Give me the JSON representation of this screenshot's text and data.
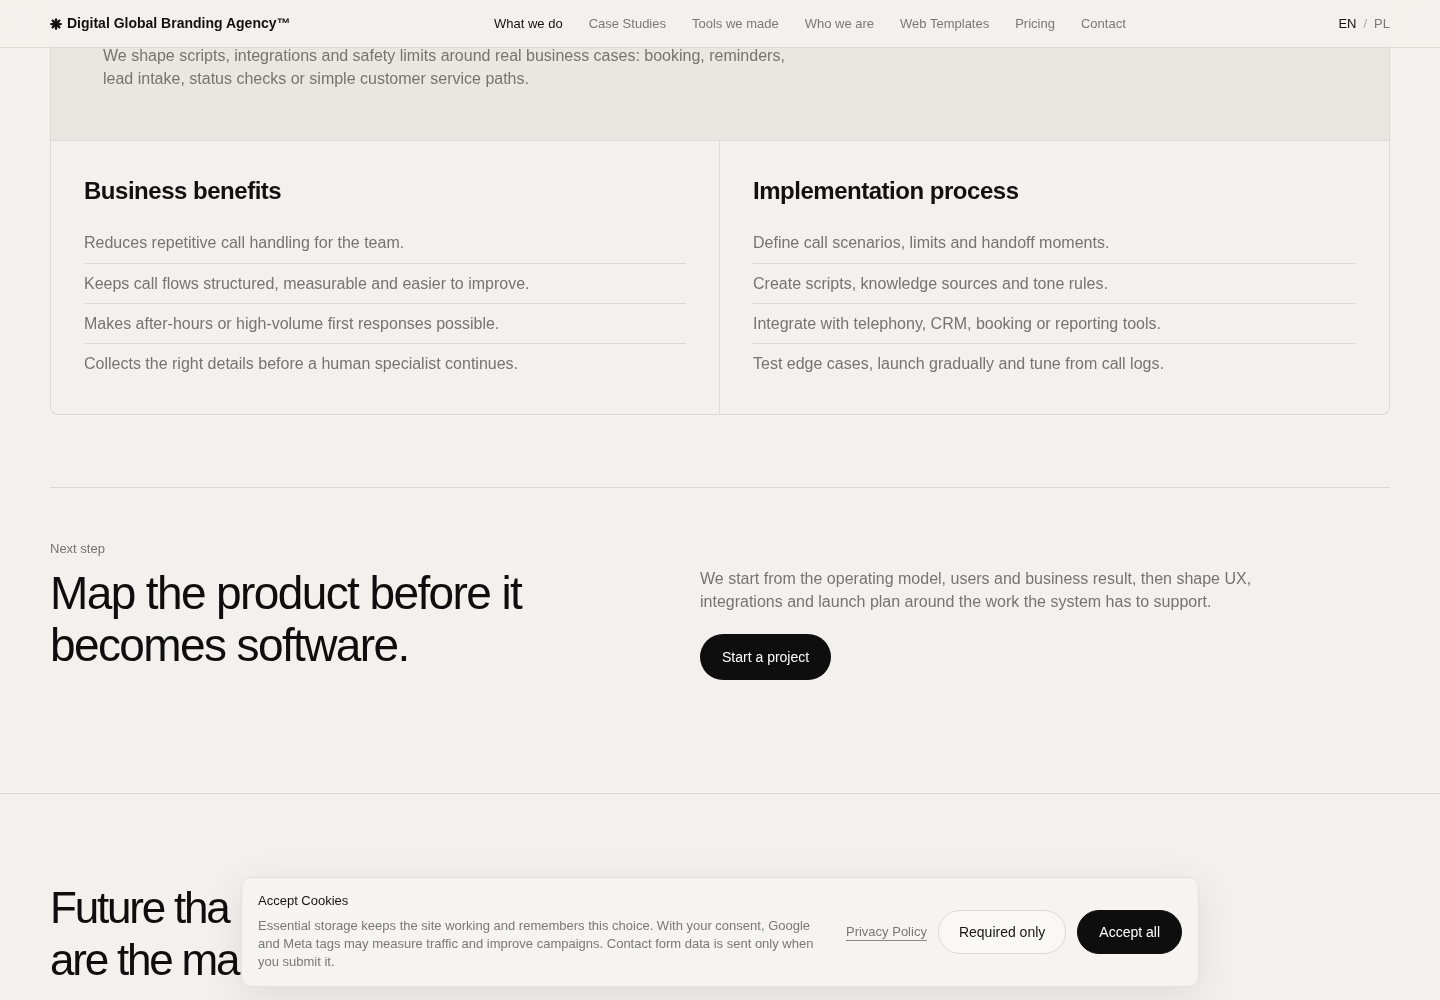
{
  "header": {
    "logo": "Digital Global Branding Agency™",
    "nav": [
      {
        "label": "What we do",
        "selected": true
      },
      {
        "label": "Case Studies",
        "selected": false
      },
      {
        "label": "Tools we made",
        "selected": false
      },
      {
        "label": "Who we are",
        "selected": false
      },
      {
        "label": "Web Templates",
        "selected": false
      },
      {
        "label": "Pricing",
        "selected": false
      },
      {
        "label": "Contact",
        "selected": false
      }
    ],
    "languages": [
      {
        "label": "EN",
        "selected": true
      },
      {
        "label": "PL",
        "selected": false
      }
    ],
    "language_separator": "/"
  },
  "intro": {
    "text": "We shape scripts, integrations and safety limits around real business cases: booking, reminders, lead intake, status checks or simple customer service paths."
  },
  "columns": [
    {
      "title": "Business benefits",
      "items": [
        "Reduces repetitive call handling for the team.",
        "Keeps call flows structured, measurable and easier to improve.",
        "Makes after-hours or high-volume first responses possible.",
        "Collects the right details before a human specialist continues."
      ]
    },
    {
      "title": "Implementation process",
      "items": [
        "Define call scenarios, limits and handoff moments.",
        "Create scripts, knowledge sources and tone rules.",
        "Integrate with telephony, CRM, booking or reporting tools.",
        "Test edge cases, launch gradually and tune from call logs."
      ]
    }
  ],
  "next_step": {
    "eyebrow": "Next step",
    "heading": "Map the product before it becomes software.",
    "text": "We start from the operating model, users and business result, then shape UX, integrations and launch plan around the work the system has to support.",
    "button": "Start a project"
  },
  "closing": {
    "heading_lines": [
      "Future tha",
      "are the ma"
    ]
  },
  "cookie_banner": {
    "title": "Accept Cookies",
    "text": "Essential storage keeps the site working and remembers this choice. With your consent, Google and Meta tags may measure traffic and improve campaigns. Contact form data is sent only when you submit it.",
    "link": "Privacy Policy",
    "buttons": [
      {
        "label": "Required only",
        "kind": "secondary"
      },
      {
        "label": "Accept all",
        "kind": "primary"
      }
    ]
  }
}
